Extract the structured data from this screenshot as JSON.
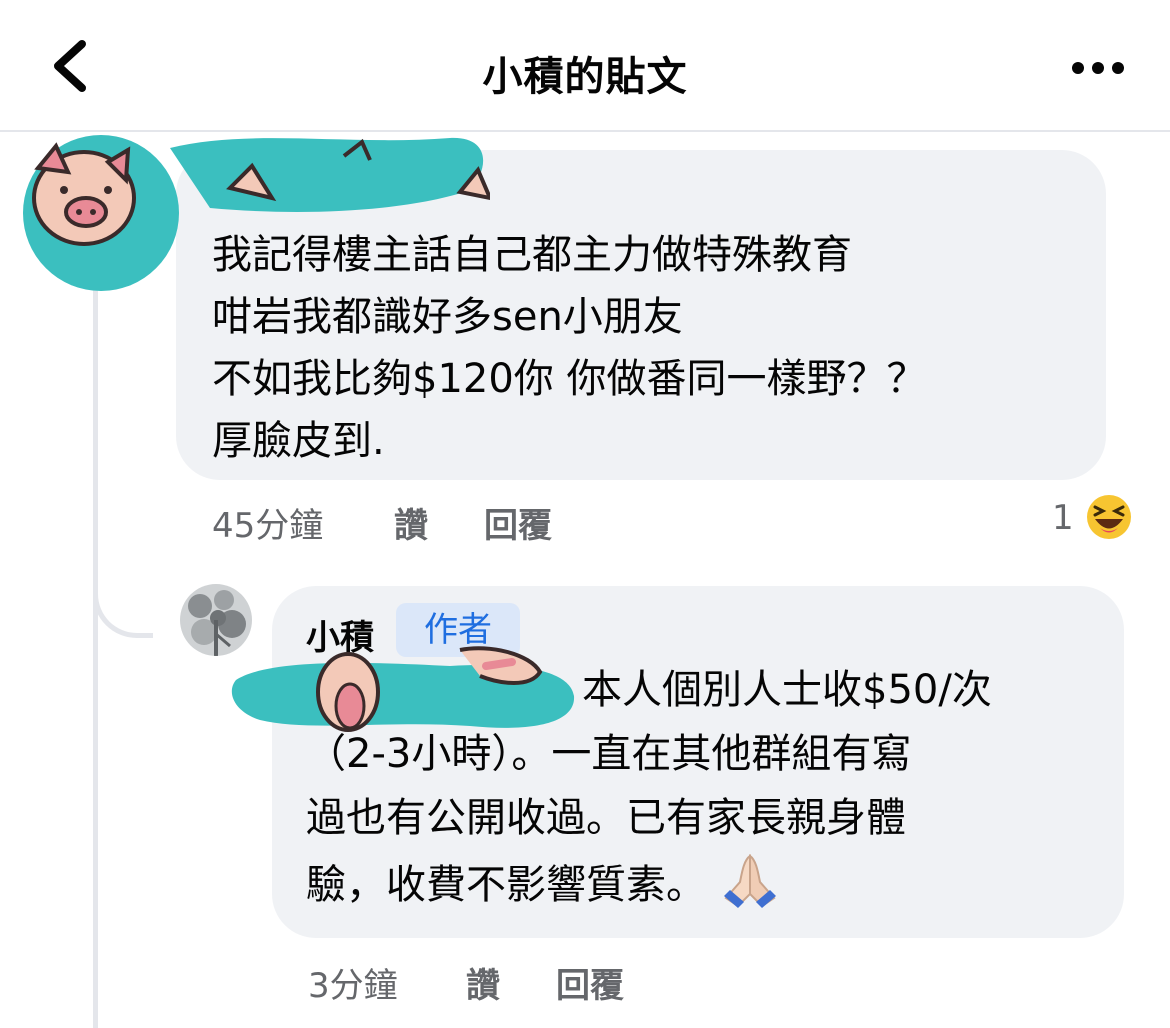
{
  "header": {
    "title": "小積的貼文",
    "back_icon": "chevron-left-icon",
    "more_icon": "more-horizontal-icon"
  },
  "comment1": {
    "lines": [
      "我記得樓主話自己都主力做特殊教育",
      "咁岩我都識好多sen小朋友",
      "不如我比夠$120你 你做番同一樣野？？",
      "厚臉皮到."
    ],
    "time": "45分鐘",
    "like_label": "讚",
    "reply_label": "回覆",
    "reaction_count": "1",
    "reaction_icon": "laughing-emoji-icon"
  },
  "reply1": {
    "author": "小積",
    "badge": "作者",
    "lines": [
      "本人個別人士收$50/次",
      "（2-3小時）。一直在其他群組有寫",
      "過也有公開收過。已有家長親身體",
      "驗，收費不影響質素。"
    ],
    "end_emoji": "folded-hands-emoji-icon",
    "time": "3分鐘",
    "like_label": "讚",
    "reply_label": "回覆"
  },
  "colors": {
    "bubble": "#f0f2f5",
    "scribble": "#3bbfbf",
    "badge_bg": "#dbe7f9",
    "badge_text": "#1f6ee0",
    "meta_text": "#65676b"
  }
}
